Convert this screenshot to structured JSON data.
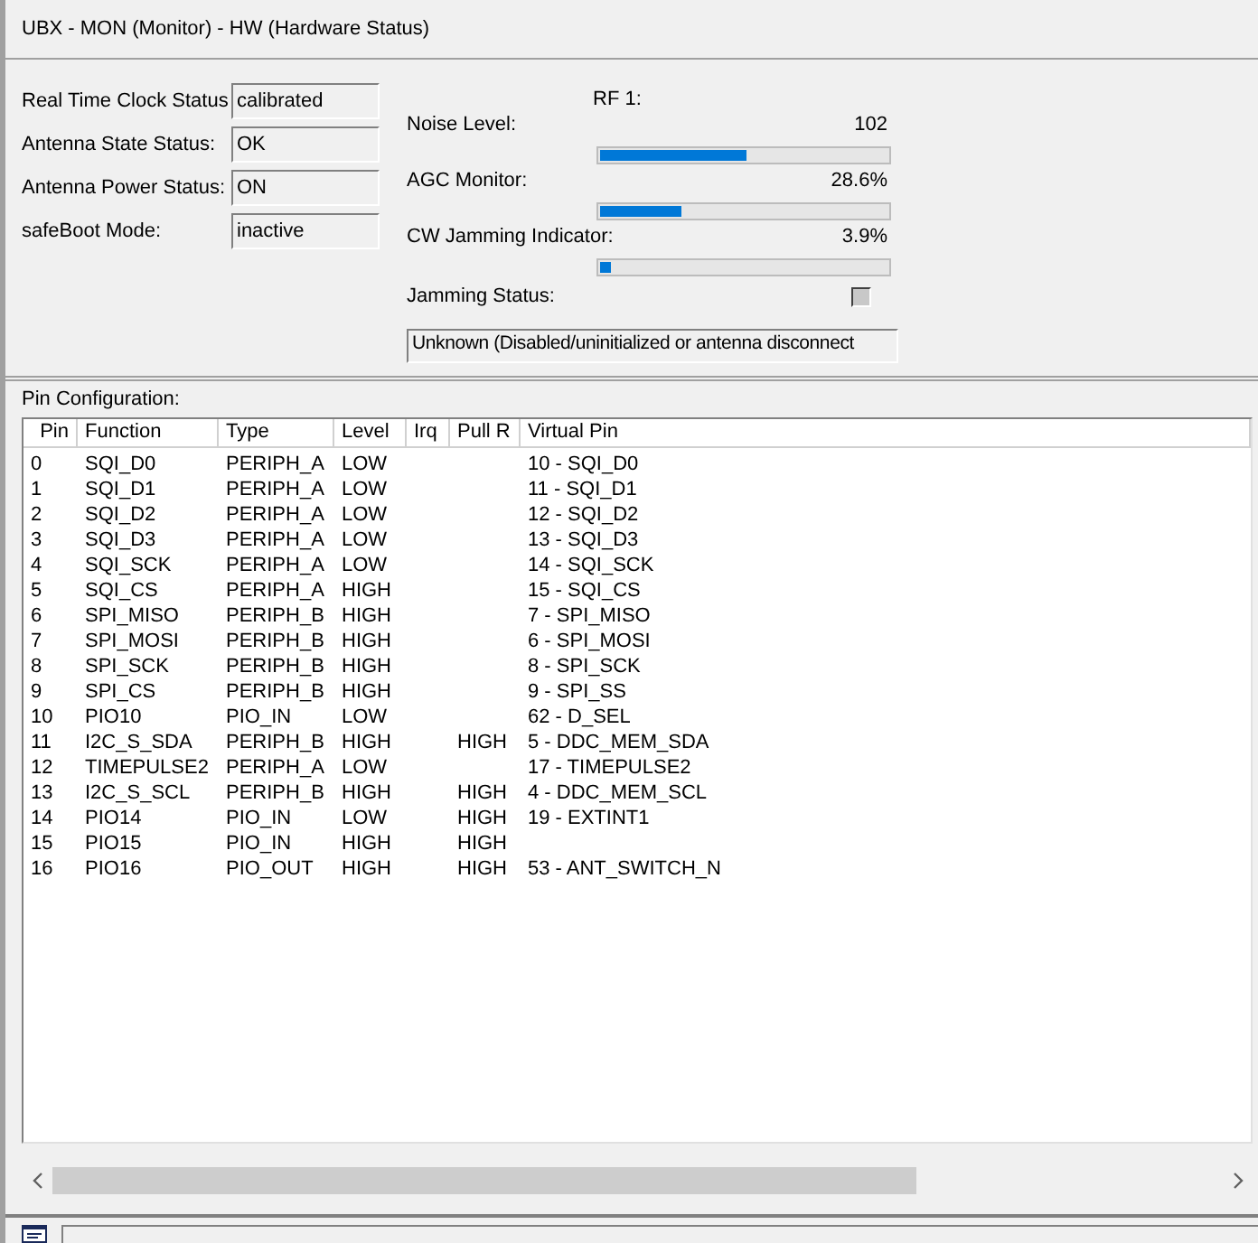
{
  "title": "UBX - MON (Monitor) - HW (Hardware Status)",
  "status_fields": [
    {
      "label": "Real Time Clock Status",
      "value": "calibrated"
    },
    {
      "label": "Antenna State Status:",
      "value": "OK"
    },
    {
      "label": "Antenna Power Status:",
      "value": "ON"
    },
    {
      "label": "safeBoot Mode:",
      "value": "inactive"
    }
  ],
  "rf": {
    "heading": "RF 1:",
    "meters": [
      {
        "label": "Noise Level:",
        "reading": "102",
        "level": 0.51
      },
      {
        "label": "AGC Monitor:",
        "reading": "28.6%",
        "level": 0.286
      },
      {
        "label": "CW Jamming Indicator:",
        "reading": "3.9%",
        "level": 0.039
      }
    ],
    "jamming_status": {
      "label": "Jamming Status:",
      "text": "Unknown (Disabled/uninitialized or antenna disconnect"
    }
  },
  "pin_configuration": {
    "label": "Pin Configuration:",
    "columns": [
      "Pin",
      "Function",
      "Type",
      "Level",
      "Irq",
      "Pull R",
      "Virtual Pin"
    ],
    "rows": [
      [
        "0",
        "SQI_D0",
        "PERIPH_A",
        "LOW",
        "",
        "",
        "10 - SQI_D0"
      ],
      [
        "1",
        "SQI_D1",
        "PERIPH_A",
        "LOW",
        "",
        "",
        "11 - SQI_D1"
      ],
      [
        "2",
        "SQI_D2",
        "PERIPH_A",
        "LOW",
        "",
        "",
        "12 - SQI_D2"
      ],
      [
        "3",
        "SQI_D3",
        "PERIPH_A",
        "LOW",
        "",
        "",
        "13 - SQI_D3"
      ],
      [
        "4",
        "SQI_SCK",
        "PERIPH_A",
        "LOW",
        "",
        "",
        "14 - SQI_SCK"
      ],
      [
        "5",
        "SQI_CS",
        "PERIPH_A",
        "HIGH",
        "",
        "",
        "15 - SQI_CS"
      ],
      [
        "6",
        "SPI_MISO",
        "PERIPH_B",
        "HIGH",
        "",
        "",
        "7 - SPI_MISO"
      ],
      [
        "7",
        "SPI_MOSI",
        "PERIPH_B",
        "HIGH",
        "",
        "",
        "6 - SPI_MOSI"
      ],
      [
        "8",
        "SPI_SCK",
        "PERIPH_B",
        "HIGH",
        "",
        "",
        "8 - SPI_SCK"
      ],
      [
        "9",
        "SPI_CS",
        "PERIPH_B",
        "HIGH",
        "",
        "",
        "9 - SPI_SS"
      ],
      [
        "10",
        "PIO10",
        "PIO_IN",
        "LOW",
        "",
        "",
        "62 - D_SEL"
      ],
      [
        "11",
        "I2C_S_SDA",
        "PERIPH_B",
        "HIGH",
        "",
        "HIGH",
        "5 - DDC_MEM_SDA"
      ],
      [
        "12",
        "TIMEPULSE2",
        "PERIPH_A",
        "LOW",
        "",
        "",
        "17 - TIMEPULSE2"
      ],
      [
        "13",
        "I2C_S_SCL",
        "PERIPH_B",
        "HIGH",
        "",
        "HIGH",
        "4 - DDC_MEM_SCL"
      ],
      [
        "14",
        "PIO14",
        "PIO_IN",
        "LOW",
        "",
        "HIGH",
        "19 - EXTINT1"
      ],
      [
        "15",
        "PIO15",
        "PIO_IN",
        "HIGH",
        "",
        "HIGH",
        ""
      ],
      [
        "16",
        "PIO16",
        "PIO_OUT",
        "HIGH",
        "",
        "HIGH",
        "53 - ANT_SWITCH_N"
      ]
    ]
  }
}
